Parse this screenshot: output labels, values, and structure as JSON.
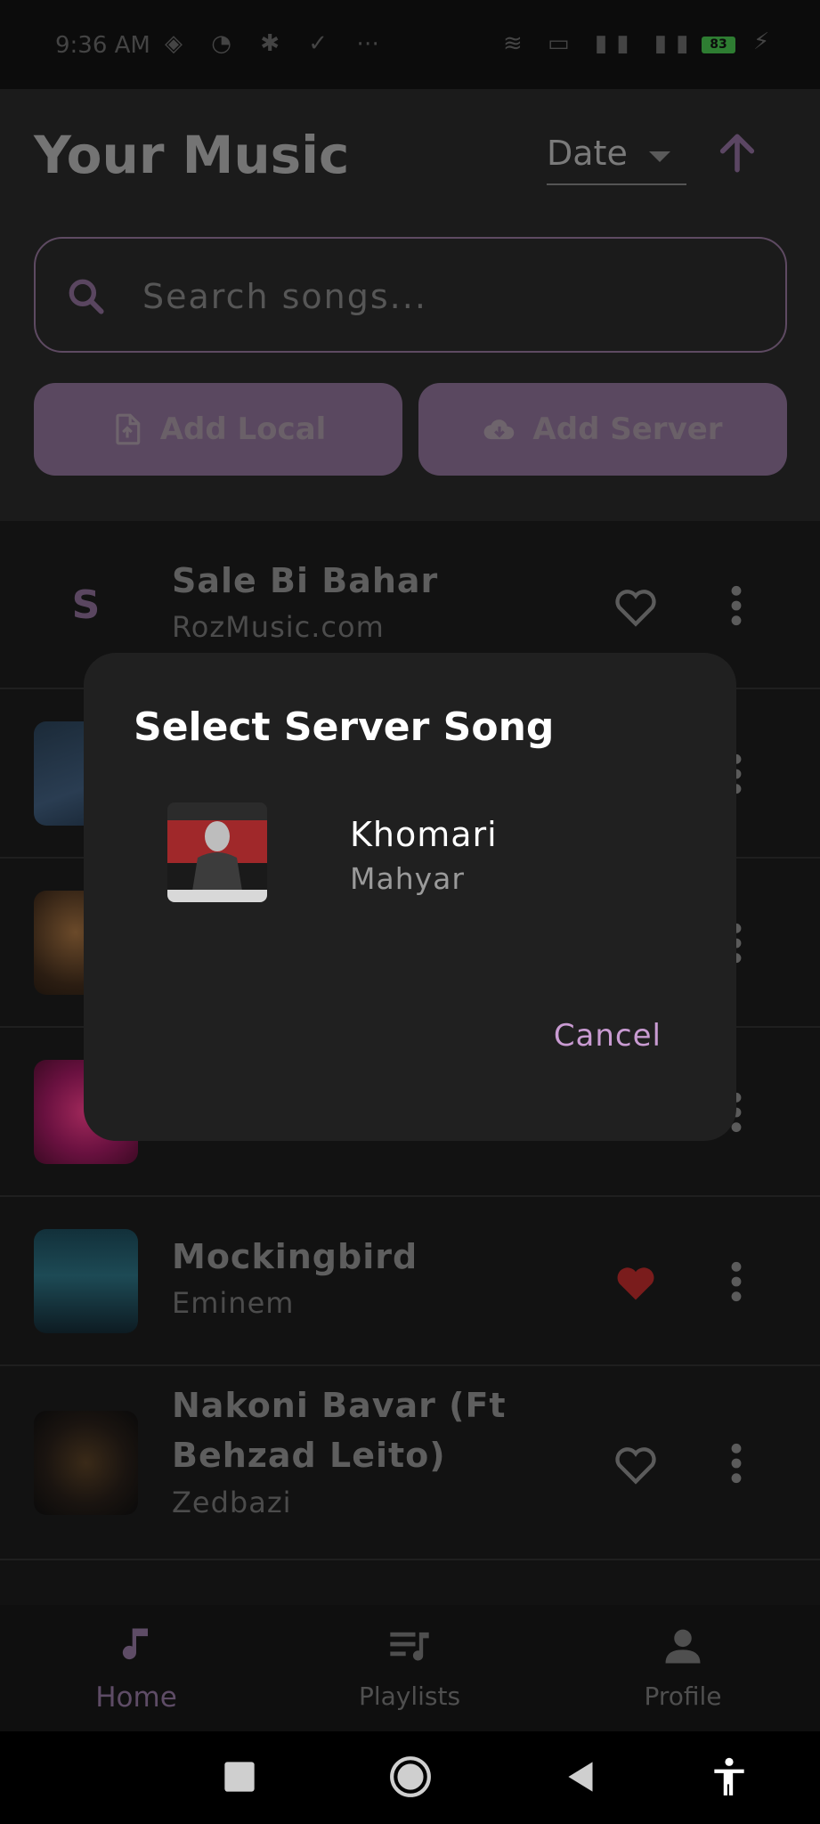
{
  "status_bar": {
    "time": "9:36 AM",
    "battery": "83"
  },
  "header": {
    "title": "Your Music",
    "sort_value": "Date"
  },
  "search": {
    "placeholder": "Search songs..."
  },
  "actions": {
    "add_local": "Add Local",
    "add_server": "Add Server"
  },
  "songs": [
    {
      "title": "Sale Bi Bahar",
      "artist": "RozMusic.com",
      "art_letter": "S",
      "favorite": false
    },
    {
      "title": "",
      "artist": "",
      "favorite": false
    },
    {
      "title": "",
      "artist": "",
      "favorite": false
    },
    {
      "title": "",
      "artist": "",
      "favorite": false
    },
    {
      "title": "Mockingbird",
      "artist": "Eminem",
      "favorite": true
    },
    {
      "title_line1": "Nakoni Bavar (Ft",
      "title_line2": "Behzad Leito)",
      "artist": "Zedbazi",
      "favorite": false
    }
  ],
  "dialog": {
    "title": "Select Server Song",
    "item_title": "Khomari",
    "item_artist": "Mahyar",
    "cancel": "Cancel"
  },
  "bottom_nav": {
    "home": "Home",
    "playlists": "Playlists",
    "profile": "Profile"
  },
  "colors": {
    "accent": "#c99bd2",
    "favorite": "#c62828"
  }
}
